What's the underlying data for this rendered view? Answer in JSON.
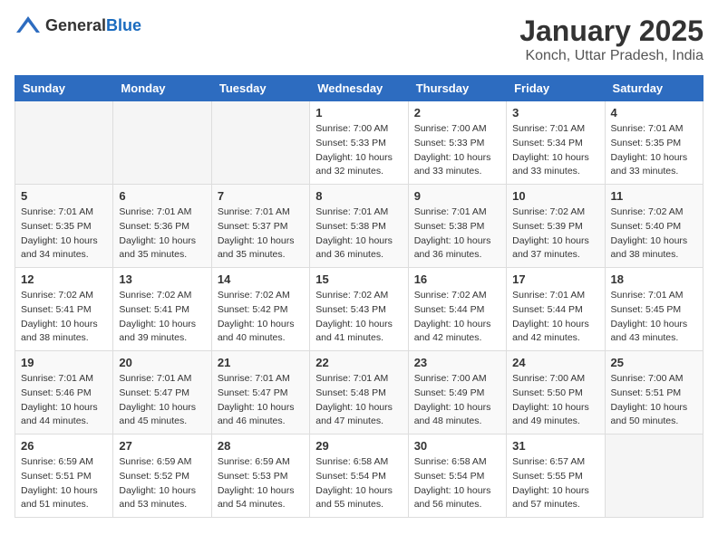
{
  "header": {
    "logo_general": "General",
    "logo_blue": "Blue",
    "title": "January 2025",
    "location": "Konch, Uttar Pradesh, India"
  },
  "days_of_week": [
    "Sunday",
    "Monday",
    "Tuesday",
    "Wednesday",
    "Thursday",
    "Friday",
    "Saturday"
  ],
  "weeks": [
    [
      {
        "day": "",
        "info": ""
      },
      {
        "day": "",
        "info": ""
      },
      {
        "day": "",
        "info": ""
      },
      {
        "day": "1",
        "info": "Sunrise: 7:00 AM\nSunset: 5:33 PM\nDaylight: 10 hours\nand 32 minutes."
      },
      {
        "day": "2",
        "info": "Sunrise: 7:00 AM\nSunset: 5:33 PM\nDaylight: 10 hours\nand 33 minutes."
      },
      {
        "day": "3",
        "info": "Sunrise: 7:01 AM\nSunset: 5:34 PM\nDaylight: 10 hours\nand 33 minutes."
      },
      {
        "day": "4",
        "info": "Sunrise: 7:01 AM\nSunset: 5:35 PM\nDaylight: 10 hours\nand 33 minutes."
      }
    ],
    [
      {
        "day": "5",
        "info": "Sunrise: 7:01 AM\nSunset: 5:35 PM\nDaylight: 10 hours\nand 34 minutes."
      },
      {
        "day": "6",
        "info": "Sunrise: 7:01 AM\nSunset: 5:36 PM\nDaylight: 10 hours\nand 35 minutes."
      },
      {
        "day": "7",
        "info": "Sunrise: 7:01 AM\nSunset: 5:37 PM\nDaylight: 10 hours\nand 35 minutes."
      },
      {
        "day": "8",
        "info": "Sunrise: 7:01 AM\nSunset: 5:38 PM\nDaylight: 10 hours\nand 36 minutes."
      },
      {
        "day": "9",
        "info": "Sunrise: 7:01 AM\nSunset: 5:38 PM\nDaylight: 10 hours\nand 36 minutes."
      },
      {
        "day": "10",
        "info": "Sunrise: 7:02 AM\nSunset: 5:39 PM\nDaylight: 10 hours\nand 37 minutes."
      },
      {
        "day": "11",
        "info": "Sunrise: 7:02 AM\nSunset: 5:40 PM\nDaylight: 10 hours\nand 38 minutes."
      }
    ],
    [
      {
        "day": "12",
        "info": "Sunrise: 7:02 AM\nSunset: 5:41 PM\nDaylight: 10 hours\nand 38 minutes."
      },
      {
        "day": "13",
        "info": "Sunrise: 7:02 AM\nSunset: 5:41 PM\nDaylight: 10 hours\nand 39 minutes."
      },
      {
        "day": "14",
        "info": "Sunrise: 7:02 AM\nSunset: 5:42 PM\nDaylight: 10 hours\nand 40 minutes."
      },
      {
        "day": "15",
        "info": "Sunrise: 7:02 AM\nSunset: 5:43 PM\nDaylight: 10 hours\nand 41 minutes."
      },
      {
        "day": "16",
        "info": "Sunrise: 7:02 AM\nSunset: 5:44 PM\nDaylight: 10 hours\nand 42 minutes."
      },
      {
        "day": "17",
        "info": "Sunrise: 7:01 AM\nSunset: 5:44 PM\nDaylight: 10 hours\nand 42 minutes."
      },
      {
        "day": "18",
        "info": "Sunrise: 7:01 AM\nSunset: 5:45 PM\nDaylight: 10 hours\nand 43 minutes."
      }
    ],
    [
      {
        "day": "19",
        "info": "Sunrise: 7:01 AM\nSunset: 5:46 PM\nDaylight: 10 hours\nand 44 minutes."
      },
      {
        "day": "20",
        "info": "Sunrise: 7:01 AM\nSunset: 5:47 PM\nDaylight: 10 hours\nand 45 minutes."
      },
      {
        "day": "21",
        "info": "Sunrise: 7:01 AM\nSunset: 5:47 PM\nDaylight: 10 hours\nand 46 minutes."
      },
      {
        "day": "22",
        "info": "Sunrise: 7:01 AM\nSunset: 5:48 PM\nDaylight: 10 hours\nand 47 minutes."
      },
      {
        "day": "23",
        "info": "Sunrise: 7:00 AM\nSunset: 5:49 PM\nDaylight: 10 hours\nand 48 minutes."
      },
      {
        "day": "24",
        "info": "Sunrise: 7:00 AM\nSunset: 5:50 PM\nDaylight: 10 hours\nand 49 minutes."
      },
      {
        "day": "25",
        "info": "Sunrise: 7:00 AM\nSunset: 5:51 PM\nDaylight: 10 hours\nand 50 minutes."
      }
    ],
    [
      {
        "day": "26",
        "info": "Sunrise: 6:59 AM\nSunset: 5:51 PM\nDaylight: 10 hours\nand 51 minutes."
      },
      {
        "day": "27",
        "info": "Sunrise: 6:59 AM\nSunset: 5:52 PM\nDaylight: 10 hours\nand 53 minutes."
      },
      {
        "day": "28",
        "info": "Sunrise: 6:59 AM\nSunset: 5:53 PM\nDaylight: 10 hours\nand 54 minutes."
      },
      {
        "day": "29",
        "info": "Sunrise: 6:58 AM\nSunset: 5:54 PM\nDaylight: 10 hours\nand 55 minutes."
      },
      {
        "day": "30",
        "info": "Sunrise: 6:58 AM\nSunset: 5:54 PM\nDaylight: 10 hours\nand 56 minutes."
      },
      {
        "day": "31",
        "info": "Sunrise: 6:57 AM\nSunset: 5:55 PM\nDaylight: 10 hours\nand 57 minutes."
      },
      {
        "day": "",
        "info": ""
      }
    ]
  ]
}
